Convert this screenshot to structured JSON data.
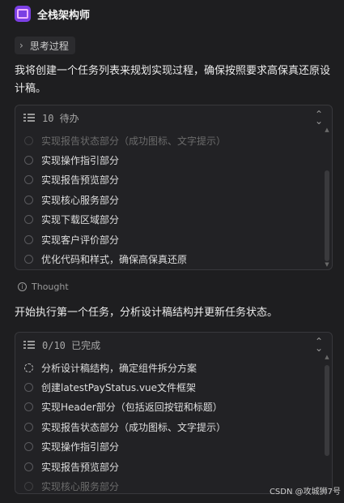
{
  "header": {
    "agent_name": "全栈架构师"
  },
  "thinking": {
    "label": "思考过程"
  },
  "paragraphs": {
    "intro": "我将创建一个任务列表来规划实现过程，确保按照要求高保真还原设计稿。",
    "start": "开始执行第一个任务，分析设计稿结构并更新任务状态。"
  },
  "todo1": {
    "title": "10 待办",
    "items": [
      {
        "label": "实现报告状态部分（成功图标、文字提示）",
        "state": "faded"
      },
      {
        "label": "实现操作指引部分",
        "state": "pending"
      },
      {
        "label": "实现报告预览部分",
        "state": "pending"
      },
      {
        "label": "实现核心服务部分",
        "state": "pending"
      },
      {
        "label": "实现下载区域部分",
        "state": "pending"
      },
      {
        "label": "实现客户评价部分",
        "state": "pending"
      },
      {
        "label": "优化代码和样式，确保高保真还原",
        "state": "pending"
      }
    ]
  },
  "thought": {
    "label": "Thought"
  },
  "todo2": {
    "title": "0/10 已完成",
    "items": [
      {
        "label": "分析设计稿结构，确定组件拆分方案",
        "state": "in-progress"
      },
      {
        "label": "创建latestPayStatus.vue文件框架",
        "state": "pending"
      },
      {
        "label": "实现Header部分（包括返回按钮和标题）",
        "state": "pending"
      },
      {
        "label": "实现报告状态部分（成功图标、文字提示）",
        "state": "pending"
      },
      {
        "label": "实现操作指引部分",
        "state": "pending"
      },
      {
        "label": "实现报告预览部分",
        "state": "pending"
      },
      {
        "label": "实现核心服务部分",
        "state": "faded"
      }
    ]
  },
  "watermark": "CSDN @攻城狮7号",
  "colors": {
    "background": "#1e1e20",
    "card": "#222225",
    "border": "#38383c",
    "logo": "#7b3fe4"
  },
  "icons": {
    "logo": "agent-logo-icon",
    "expand": "chevron-right-icon",
    "list": "todo-list-icon",
    "collapse": "collapse-icon",
    "info": "info-icon"
  }
}
